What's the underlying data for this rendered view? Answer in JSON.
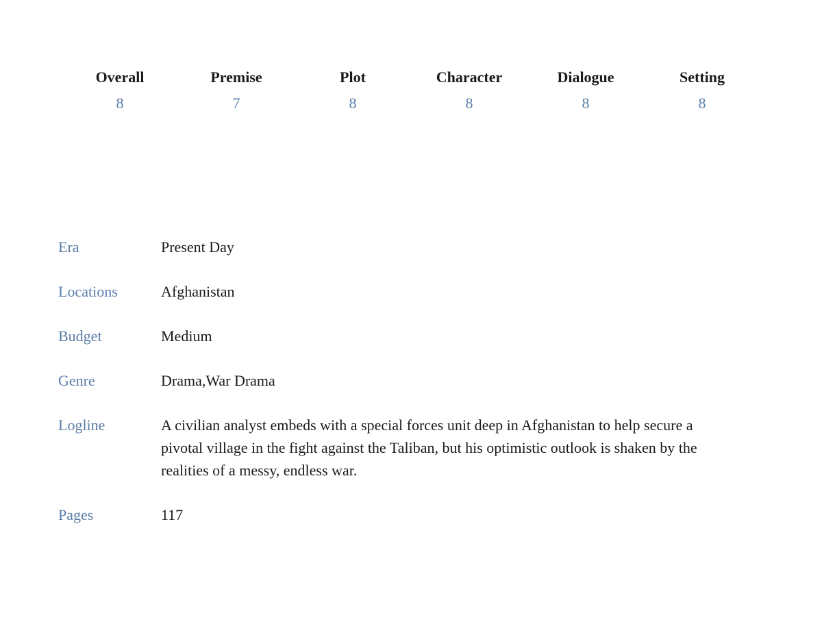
{
  "scores": [
    {
      "label": "Overall",
      "value": "8"
    },
    {
      "label": "Premise",
      "value": "7"
    },
    {
      "label": "Plot",
      "value": "8"
    },
    {
      "label": "Character",
      "value": "8"
    },
    {
      "label": "Dialogue",
      "value": "8"
    },
    {
      "label": "Setting",
      "value": "8"
    }
  ],
  "details": {
    "era": {
      "label": "Era",
      "value": "Present Day"
    },
    "locations": {
      "label": "Locations",
      "value": "Afghanistan"
    },
    "budget": {
      "label": "Budget",
      "value": "Medium"
    },
    "genre": {
      "label": "Genre",
      "value": "Drama,War Drama"
    },
    "logline": {
      "label": "Logline",
      "value": "A civilian analyst embeds with a special forces unit deep in Afghanistan to help secure a pivotal village in the fight against the Taliban, but his optimistic outlook is shaken by the realities of a messy, endless war."
    },
    "pages": {
      "label": "Pages",
      "value": "117"
    }
  }
}
